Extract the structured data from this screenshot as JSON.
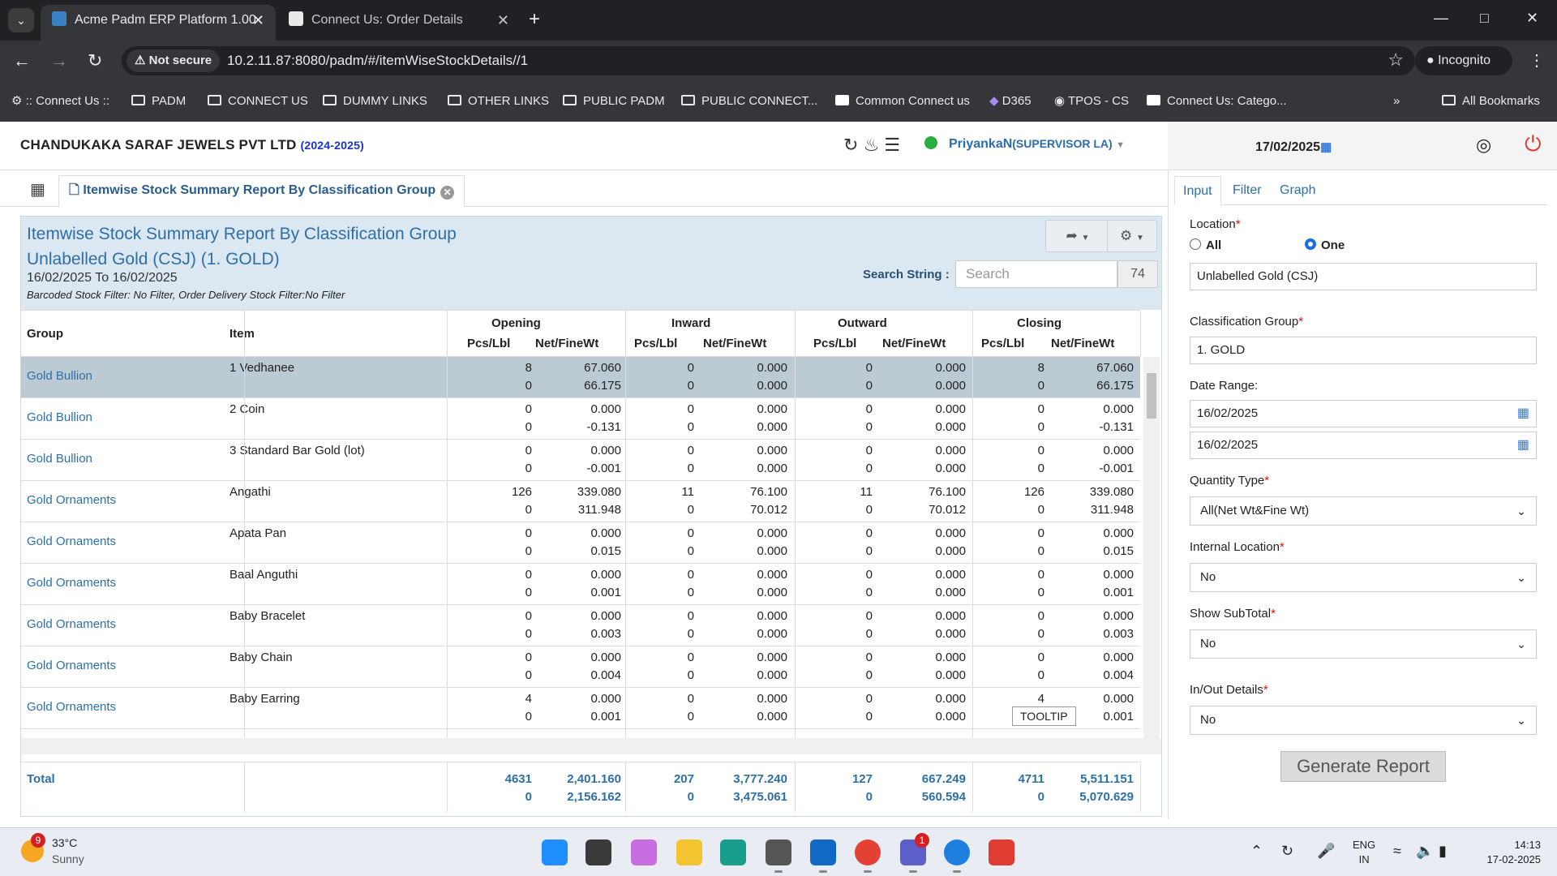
{
  "browser": {
    "tabs": [
      {
        "title": "Acme Padm ERP Platform 1.00",
        "active": true
      },
      {
        "title": "Connect Us: Order Details",
        "active": false
      }
    ],
    "not_secure": "Not secure",
    "url": "10.2.11.87:8080/padm/#/itemWiseStockDetails//1",
    "incognito": "Incognito",
    "bookmarks": [
      ":: Connect Us ::",
      "PADM",
      "CONNECT US",
      "DUMMY LINKS",
      "OTHER LINKS",
      "PUBLIC PADM",
      "PUBLIC CONNECT...",
      "Common Connect us",
      "D365",
      "TPOS - CS",
      "Connect Us: Catego..."
    ],
    "all_bookmarks": "All Bookmarks"
  },
  "header": {
    "company": "CHANDUKAKA SARAF JEWELS PVT LTD",
    "year": "(2024-2025)",
    "user": "PriyankaN",
    "role": "(SUPERVISOR LA)",
    "date": "17/02/2025"
  },
  "page_tab": "Itemwise Stock Summary Report By Classification Group",
  "report": {
    "title": "Itemwise Stock Summary Report By Classification Group",
    "subtitle": "Unlabelled Gold (CSJ) (1. GOLD)",
    "date_range": "16/02/2025 To 16/02/2025",
    "filter_note": "Barcoded Stock Filter: No Filter, Order Delivery Stock Filter:No Filter",
    "search_label": "Search String :",
    "search_placeholder": "Search",
    "count": "74",
    "columns": {
      "group": "Group",
      "item": "Item",
      "opening": "Opening",
      "inward": "Inward",
      "outward": "Outward",
      "closing": "Closing",
      "pcs": "Pcs/Lbl",
      "net": "Net/FineWt"
    },
    "rows": [
      {
        "group": "Gold Bullion",
        "item": "1 Vedhanee",
        "v": [
          [
            "8",
            "67.060",
            "0",
            "0.000",
            "0",
            "0.000",
            "8",
            "67.060"
          ],
          [
            "0",
            "66.175",
            "0",
            "0.000",
            "0",
            "0.000",
            "0",
            "66.175"
          ]
        ]
      },
      {
        "group": "Gold Bullion",
        "item": "2 Coin",
        "v": [
          [
            "0",
            "0.000",
            "0",
            "0.000",
            "0",
            "0.000",
            "0",
            "0.000"
          ],
          [
            "0",
            "-0.131",
            "0",
            "0.000",
            "0",
            "0.000",
            "0",
            "-0.131"
          ]
        ]
      },
      {
        "group": "Gold Bullion",
        "item": "3 Standard Bar Gold (lot)",
        "v": [
          [
            "0",
            "0.000",
            "0",
            "0.000",
            "0",
            "0.000",
            "0",
            "0.000"
          ],
          [
            "0",
            "-0.001",
            "0",
            "0.000",
            "0",
            "0.000",
            "0",
            "-0.001"
          ]
        ]
      },
      {
        "group": "Gold Ornaments",
        "item": "Angathi",
        "v": [
          [
            "126",
            "339.080",
            "11",
            "76.100",
            "11",
            "76.100",
            "126",
            "339.080"
          ],
          [
            "0",
            "311.948",
            "0",
            "70.012",
            "0",
            "70.012",
            "0",
            "311.948"
          ]
        ]
      },
      {
        "group": "Gold Ornaments",
        "item": "Apata Pan",
        "v": [
          [
            "0",
            "0.000",
            "0",
            "0.000",
            "0",
            "0.000",
            "0",
            "0.000"
          ],
          [
            "0",
            "0.015",
            "0",
            "0.000",
            "0",
            "0.000",
            "0",
            "0.015"
          ]
        ]
      },
      {
        "group": "Gold Ornaments",
        "item": "Baal Anguthi",
        "v": [
          [
            "0",
            "0.000",
            "0",
            "0.000",
            "0",
            "0.000",
            "0",
            "0.000"
          ],
          [
            "0",
            "0.001",
            "0",
            "0.000",
            "0",
            "0.000",
            "0",
            "0.001"
          ]
        ]
      },
      {
        "group": "Gold Ornaments",
        "item": "Baby Bracelet",
        "v": [
          [
            "0",
            "0.000",
            "0",
            "0.000",
            "0",
            "0.000",
            "0",
            "0.000"
          ],
          [
            "0",
            "0.003",
            "0",
            "0.000",
            "0",
            "0.000",
            "0",
            "0.003"
          ]
        ]
      },
      {
        "group": "Gold Ornaments",
        "item": "Baby Chain",
        "v": [
          [
            "0",
            "0.000",
            "0",
            "0.000",
            "0",
            "0.000",
            "0",
            "0.000"
          ],
          [
            "0",
            "0.004",
            "0",
            "0.000",
            "0",
            "0.000",
            "0",
            "0.004"
          ]
        ]
      },
      {
        "group": "Gold Ornaments",
        "item": "Baby Earring",
        "v": [
          [
            "4",
            "0.000",
            "0",
            "0.000",
            "0",
            "0.000",
            "4",
            "0.000"
          ],
          [
            "0",
            "0.001",
            "0",
            "0.000",
            "0",
            "0.000",
            "0",
            "0.001"
          ]
        ]
      }
    ],
    "tooltip": "TOOLTIP",
    "total_label": "Total",
    "totals": [
      [
        "4631",
        "2,401.160",
        "207",
        "3,777.240",
        "127",
        "667.249",
        "4711",
        "5,511.151"
      ],
      [
        "0",
        "2,156.162",
        "0",
        "3,475.061",
        "0",
        "560.594",
        "0",
        "5,070.629"
      ]
    ]
  },
  "panel": {
    "tabs": [
      "Input",
      "Filter",
      "Graph"
    ],
    "location_label": "Location",
    "opt_all": "All",
    "opt_one": "One",
    "location_value": "Unlabelled Gold (CSJ)",
    "class_label": "Classification Group",
    "class_value": "1. GOLD",
    "date_label": "Date Range:",
    "date_from": "16/02/2025",
    "date_to": "16/02/2025",
    "qty_label": "Quantity Type",
    "qty_value": "All(Net Wt&Fine Wt)",
    "int_label": "Internal Location",
    "int_value": "No",
    "sub_label": "Show SubTotal",
    "sub_value": "No",
    "io_label": "In/Out Details",
    "io_value": "No",
    "generate": "Generate Report"
  },
  "taskbar": {
    "weather_badge": "9",
    "temp": "33°C",
    "cond": "Sunny",
    "teams_badge": "1",
    "lang1": "ENG",
    "lang2": "IN",
    "time": "14:13",
    "date": "17-02-2025"
  }
}
